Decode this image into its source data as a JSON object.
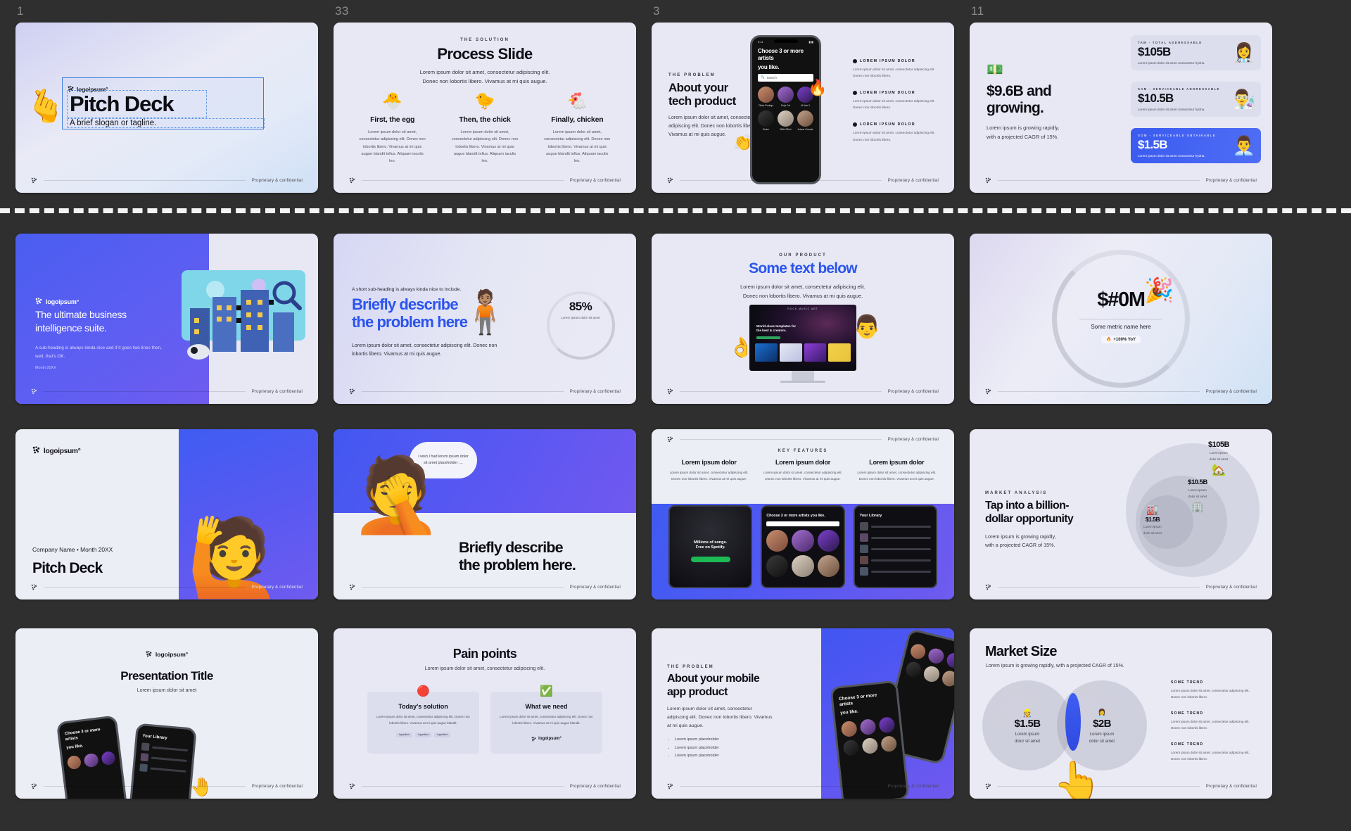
{
  "app": {
    "background": "#2f2f2f",
    "slide_bg": "#e7e8f3",
    "accent": "#3d7de0",
    "brand_blue": "#2b54ee"
  },
  "common": {
    "footer_note": "Proprietary & confidential",
    "logo_text": "logoipsum°",
    "lorem_short": "Lorem ipsum dolor sit amet, consectetur adipiscing elit.",
    "lorem_line2": "Donec non lobortis libero. Vivamus at mi quis augue.",
    "lorem_block": "Lorem ipsum dolor sit amet, consectetur adipiscing elit. Donec non lobortis libero. Vivamus at mi quis augue.",
    "lorem_tiny": "Lorem ipsum dolor sit amet, consectetur adipiscing elit. Donec non lobortis libero. Vivamus at mi quis augue blandit tellus. Aliquam iaculis leo.",
    "bullet_label": "LOREM IPSUM DOLOR",
    "some_trend": "SOME TREND"
  },
  "slides": {
    "s1": {
      "number": "1",
      "logo": "logoipsum°",
      "title": "Pitch Deck",
      "tagline": "A brief slogan or tagline.",
      "selected": true,
      "cursor_emoji": "🫰"
    },
    "s2": {
      "number": "33",
      "eyebrow": "THE SOLUTION",
      "title": "Process Slide",
      "sub_line1": "Lorem ipsum dolor sit amet, consectetur adipiscing elit.",
      "sub_line2": "Donec non lobortis libero. Vivamus at mi quis augue.",
      "columns": [
        {
          "emoji": "🐣",
          "title": "First, the egg",
          "body": "Lorem ipsum dolor sit amet, consectetur adipiscing elit. Donec non lobortis libero. Vivamus at mi quis augue blandit tellus. Aliquam iaculis leo."
        },
        {
          "emoji": "🐤",
          "title": "Then, the chick",
          "body": "Lorem ipsum dolor sit amet, consectetur adipiscing elit. Donec non lobortis libero. Vivamus at mi quis augue blandit tellus. Aliquam iaculis leo."
        },
        {
          "emoji": "🐔",
          "title": "Finally, chicken",
          "body": "Lorem ipsum dolor sit amet, consectetur adipiscing elit. Donec non lobortis libero. Vivamus at mi quis augue blandit tellus. Aliquam iaculis leo."
        }
      ]
    },
    "s3": {
      "number": "3",
      "eyebrow": "THE PROBLEM",
      "title_l1": "About your",
      "title_l2": "tech product",
      "body": "Lorem ipsum dolor sit amet, consectetur adipiscing elit. Donec non lobortis libero. Vivamus at mi quis augue.",
      "phone_title_l1": "Choose 3 or more artists",
      "phone_title_l2": "you like.",
      "search_placeholder": "Search",
      "artists": [
        "Olivia Rodrigo",
        "Doja Cat",
        "Lil Nas X",
        "Drake",
        "Billie Eilish",
        "Ariana Grande"
      ],
      "bullets": [
        {
          "label": "LOREM IPSUM DOLOR",
          "body": "Lorem ipsum dolor sit amet, consectetur adipiscing elit. Donec non lobortis libero."
        },
        {
          "label": "LOREM IPSUM DOLOR",
          "body": "Lorem ipsum dolor sit amet, consectetur adipiscing elit. Donec non lobortis libero."
        },
        {
          "label": "LOREM IPSUM DOLOR",
          "body": "Lorem ipsum dolor sit amet, consectetur adipiscing elit. Donec non lobortis libero."
        }
      ],
      "emoji_fire": "🔥",
      "emoji_clap": "👏"
    },
    "s4": {
      "number": "11",
      "emoji_money": "💵",
      "title_l1": "$9.6B and",
      "title_l2": "growing.",
      "body_l1": "Lorem ipsum is growing rapidly,",
      "body_l2": "with a projected CAGR of 15%.",
      "cards": [
        {
          "kicker": "TAM - TOTAL ADDRESSABLE",
          "value": "$105B",
          "body": "Lorem ipsum dolor sit amet consectetur hydna.",
          "emoji": "👩‍⚕️",
          "accent": false
        },
        {
          "kicker": "SAM - SERVICEABLE ADDRESSABLE",
          "value": "$10.5B",
          "body": "Lorem ipsum dolor sit amet consectetur hydna.",
          "emoji": "👨‍🔬",
          "accent": false
        },
        {
          "kicker": "SOM - SERVICEABLE OBTAINABLE",
          "value": "$1.5B",
          "body": "Lorem ipsum dolor sit amet consectetur hydna.",
          "emoji": "👨‍💼",
          "accent": true
        }
      ]
    },
    "r2c1": {
      "logo": "logoipsum°",
      "title_l1": "The ultimate business",
      "title_l2": "intelligence suite.",
      "sub_l1": "A sub-heading is always kinda nice and if it",
      "sub_l2": "goes two lines then, well, that's OK.",
      "date": "Month 20XX"
    },
    "r2c2": {
      "sub": "A short sub-heading is always kinda nice to include.",
      "title_l1": "Briefly describe",
      "title_l2": "the problem here",
      "body_l1": "Lorem ipsum dolor sit amet, consectetur adipiscing elit.",
      "body_l2": "Donec non lobortis libero. Vivamus at mi quis augue.",
      "pct_value": "85%",
      "pct_label": "Lorem ipsum dolor sit amet",
      "emoji_person": "🧍🏽"
    },
    "r2c3": {
      "eyebrow": "OUR PRODUCT",
      "title": "Some text below",
      "sub_l1": "Lorem ipsum dolor sit amet, consectetur adipiscing elit.",
      "sub_l2": "Donec non lobortis libero. Vivamus at mi quis augue.",
      "screen_topbar": "ROCK MUSIC ART",
      "screen_title_l1": "World-class templates for",
      "screen_title_l2": "the best & creators.",
      "emoji_ok": "👌",
      "emoji_face": "👨"
    },
    "r2c4": {
      "value": "$#0M",
      "metric_label": "Some metric name here",
      "chip_emoji": "🔥",
      "chip_text": "+100% YoY",
      "emoji_party": "🎉"
    },
    "r3c1": {
      "logo": "logoipsum°",
      "meta": "Company Name • Month 20XX",
      "title": "Pitch Deck",
      "emoji_person": "🙋"
    },
    "r3c2": {
      "bubble_text": "I wish I had lorem ipsum dolor sit amet placeholder ....",
      "title_l1": "Briefly describe",
      "title_l2": "the problem here.",
      "emoji_facepalm": "🤦"
    },
    "r3c3": {
      "eyebrow": "KEY FEATURES",
      "columns": [
        {
          "title": "Lorem ipsum dolor",
          "body": "Lorem ipsum dolor sit amet, consectetur adipiscing elit. Donec non lobortis libero. Vivamus at mi quis augue."
        },
        {
          "title": "Lorem ipsum dolor",
          "body": "Lorem ipsum dolor sit amet, consectetur adipiscing elit. Donec non lobortis libero. Vivamus at mi quis augue."
        },
        {
          "title": "Lorem ipsum dolor",
          "body": "Lorem ipsum dolor sit amet, consectetur adipiscing elit. Donec non lobortis libero. Vivamus at mi quis augue."
        }
      ],
      "phone1_title_l1": "Millions of songs.",
      "phone1_title_l2": "Free on Spotify.",
      "phone2_title": "Choose 3 or more artists you like.",
      "phone3_title": "Your Library"
    },
    "r3c4": {
      "eyebrow": "MARKET ANALYSIS",
      "title_l1": "Tap into a billion-",
      "title_l2": "dollar opportunity",
      "body_l1": "Lorem ipsum is growing rapidly,",
      "body_l2": "with a projected CAGR of 15%.",
      "rings": [
        {
          "value": "$105B",
          "desc_l1": "Lorem ipsum",
          "desc_l2": "dolor sit amet",
          "emoji": "🏡"
        },
        {
          "value": "$10.5B",
          "desc_l1": "Lorem ipsum",
          "desc_l2": "dolor sit amet",
          "emoji": "🏢"
        },
        {
          "value": "$1.5B",
          "desc_l1": "Lorem ipsum",
          "desc_l2": "dolor sit amet",
          "emoji": "🏭"
        }
      ]
    },
    "r4c1": {
      "logo": "logoipsum°",
      "title": "Presentation Title",
      "sub": "Lorem ipsum dolor sit amet",
      "emoji_hand": "🤚"
    },
    "r4c2": {
      "title": "Pain points",
      "sub": "Lorem ipsum dolor sit amet, consectetur adipiscing elit.",
      "cards": [
        {
          "emoji": "🔴",
          "title": "Today's solution",
          "body": "Lorem ipsum dolor sit amet, consectetur adipiscing elit. Donec non lobortis libero. Vivamus at mi quis augue blandit."
        },
        {
          "emoji": "✅",
          "title": "What we need",
          "body": "Lorem ipsum dolor sit amet, consectetur adipiscing elit. Donec non lobortis libero. Vivamus at mi quis augue blandit."
        }
      ],
      "pills": [
        "Ingredient",
        "Ingredient",
        "Ingredient"
      ],
      "logo": "logoipsum°"
    },
    "r4c3": {
      "eyebrow": "THE PROBLEM",
      "title_l1": "About your mobile",
      "title_l2": "app product",
      "body": "Lorem ipsum dolor sit amet, consectetur adipiscing elit. Donec non lobortis libero. Vivamus at mi quis augue.",
      "list": [
        "Lorem ipsum placeholder",
        "Lorem ipsum placeholder",
        "Lorem ipsum placeholder"
      ],
      "phone_title_l1": "Choose 3 or more artists",
      "phone_title_l2": "you like."
    },
    "r4c4": {
      "title": "Market Size",
      "sub": "Lorem ipsum is growing rapidly, with a projected CAGR of 15%.",
      "venn": [
        {
          "value": "$1.5B",
          "desc_l1": "Lorem ipsum",
          "desc_l2": "dolor sit amet",
          "emoji": "👷"
        },
        {
          "value": "$2B",
          "desc_l1": "Lorem ipsum",
          "desc_l2": "dolor sit amet",
          "emoji": "👩‍💼"
        }
      ],
      "trends": [
        {
          "title": "SOME TREND",
          "body": "Lorem ipsum dolor sit amet, consectetur adipiscing elit. Donec non lobortis libero."
        },
        {
          "title": "SOME TREND",
          "body": "Lorem ipsum dolor sit amet, consectetur adipiscing elit. Donec non lobortis libero."
        },
        {
          "title": "SOME TREND",
          "body": "Lorem ipsum dolor sit amet, consectetur adipiscing elit. Donec non lobortis libero."
        }
      ],
      "emoji_point": "👆"
    }
  }
}
